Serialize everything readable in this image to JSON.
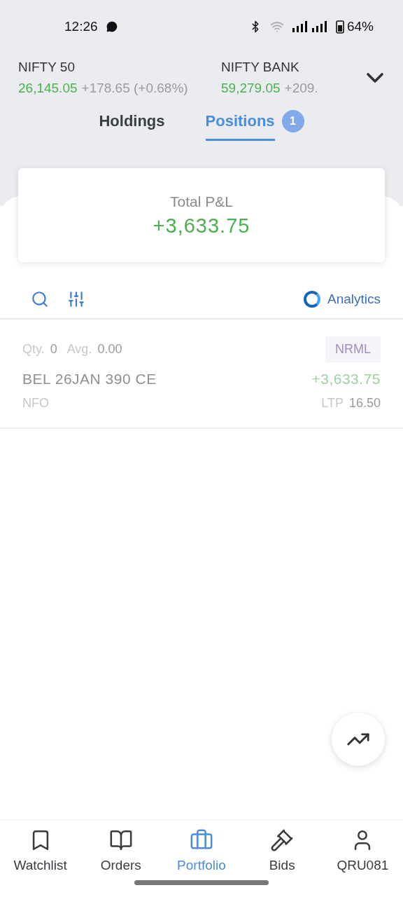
{
  "status_bar": {
    "time": "12:26",
    "battery": "64%"
  },
  "indices": [
    {
      "name": "NIFTY 50",
      "value": "26,145.05",
      "change": "+178.65 (+0.68%)"
    },
    {
      "name": "NIFTY BANK",
      "value": "59,279.05",
      "change": "+209."
    }
  ],
  "tabs": [
    {
      "label": "Holdings",
      "selected": false
    },
    {
      "label": "Positions",
      "selected": true,
      "badge": "1"
    }
  ],
  "summary": {
    "label": "Total P&L",
    "value": "+3,633.75"
  },
  "toolbar": {
    "analytics": "Analytics"
  },
  "positions": [
    {
      "qty_label": "Qty.",
      "qty": "0",
      "avg_label": "Avg.",
      "avg": "0.00",
      "product": "NRML",
      "symbol": "BEL 26JAN 390 CE",
      "pnl": "+3,633.75",
      "exchange": "NFO",
      "ltp_label": "LTP",
      "ltp": "16.50"
    }
  ],
  "nav": [
    {
      "label": "Watchlist",
      "kind": "bookmark",
      "selected": false
    },
    {
      "label": "Orders",
      "kind": "book",
      "selected": false
    },
    {
      "label": "Portfolio",
      "kind": "briefcase",
      "selected": true
    },
    {
      "label": "Bids",
      "kind": "gavel",
      "selected": false
    },
    {
      "label": "QRU081",
      "kind": "user",
      "selected": false
    }
  ]
}
